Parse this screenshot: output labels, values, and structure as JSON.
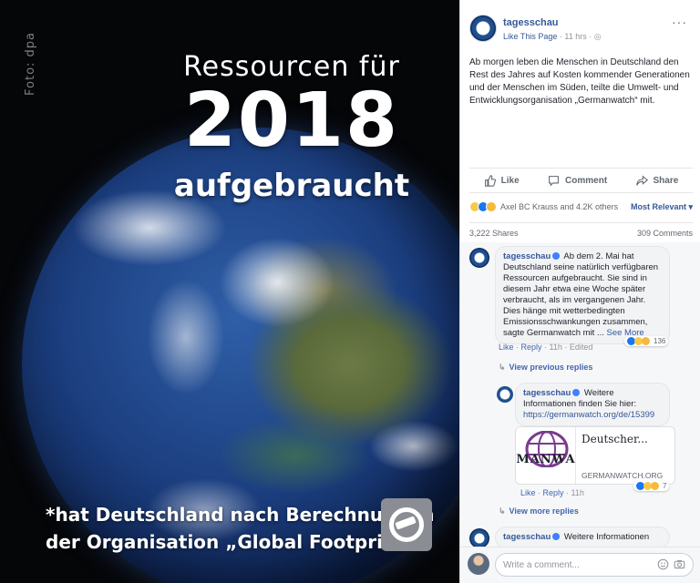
{
  "photo": {
    "credit": "Foto: dpa",
    "headline_line1": "Ressourcen für",
    "headline_line2": "2018",
    "headline_line3": "aufgebraucht",
    "footnote_line1": "*hat Deutschland nach Berechnungen",
    "footnote_line2": "der Organisation „Global Footprint“",
    "logo_icon": "tagesschau-logo-icon"
  },
  "post": {
    "page_name": "tagesschau",
    "like_page": "Like This Page",
    "time": "· 11 hrs ·",
    "more": "···",
    "text": "Ab morgen leben die Menschen in Deutschland den Rest des Jahres auf Kosten kommender Generationen und der Menschen im Süden, teilte die Umwelt- und Entwicklungsorganisation „Germanwatch“ mit.",
    "actions": {
      "like": "Like",
      "comment": "Comment",
      "share": "Share"
    },
    "reactors": "Axel BC Krauss and 4.2K others",
    "relevance": "Most Relevant ▾",
    "shares": "3,222 Shares",
    "comments_count": "309 Comments"
  },
  "comments": [
    {
      "author": "tagesschau",
      "text": "Ab dem 2. Mai hat Deutschland seine natürlich verfügbaren Ressourcen aufgebraucht. Sie sind in diesem Jahr etwa eine Woche später verbraucht, als im vergangenen Jahr. Dies hänge mit wetterbedingten Emissionsschwankungen zusammen, sagte Germanwatch mit ...",
      "see_more": "See More",
      "like": "Like",
      "reply": "Reply",
      "time": "· 11h · Edited",
      "reactions": "136",
      "previous_replies": "View previous replies"
    },
    {
      "author": "tagesschau",
      "text": "Weitere Informationen finden Sie hier:",
      "link": "https://germanwatch.org/de/15399",
      "card_brand": "MANWA",
      "card_title": "Deutscher...",
      "card_domain": "GERMANWATCH.ORG",
      "like": "Like",
      "reply": "Reply",
      "time": "· 11h",
      "reactions": "7",
      "more_replies": "View more replies"
    },
    {
      "author": "tagesschau",
      "text": "Weitere Informationen"
    }
  ],
  "composer": {
    "placeholder": "Write a comment..."
  },
  "colors": {
    "link": "#365899",
    "facebook_blue": "#4267b2",
    "like_blue": "#1877f2"
  }
}
